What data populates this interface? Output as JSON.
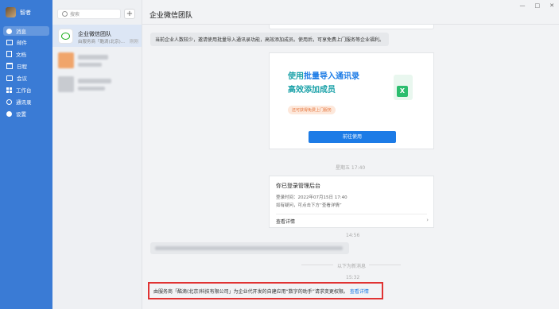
{
  "rail": {
    "user_name": "智者",
    "items": [
      {
        "label": "消息",
        "icon": "chat-icon"
      },
      {
        "label": "邮件",
        "icon": "mail-icon"
      },
      {
        "label": "文档",
        "icon": "doc-icon"
      },
      {
        "label": "日程",
        "icon": "calendar-icon"
      },
      {
        "label": "会议",
        "icon": "meeting-icon"
      },
      {
        "label": "工作台",
        "icon": "workbench-icon"
      },
      {
        "label": "通讯录",
        "icon": "contacts-icon"
      },
      {
        "label": "设置",
        "icon": "settings-icon"
      }
    ]
  },
  "list": {
    "search_placeholder": "搜索",
    "conversations": [
      {
        "name": "企业微信团队",
        "preview": "由服务商「酷滴(北京)...",
        "time": "刚刚"
      }
    ]
  },
  "main": {
    "title": "企业微信团队",
    "window_buttons": [
      "—",
      "□",
      "✕"
    ],
    "msg_intro": "当前企业人数较少，邀请使用批量导入通讯录功能，高效添加成员。使用后，可享免费上门服务等企业福利。",
    "banner": {
      "title_prefix": "使用",
      "title_highlight": "批量导入通讯录",
      "subtitle": "高效添加成员",
      "pill": "还可获得免费上门服务",
      "button": "前往使用"
    },
    "ts1": "星期五 17:40",
    "login": {
      "title": "你已登录管理后台",
      "line1": "登录时间：2022年07月15日 17:40",
      "line2": "如有疑问，可点击下方“查看详情”",
      "detail": "查看详情"
    },
    "ts2": "14:56",
    "new_msg_notice": "以下为新消息",
    "ts3": "15:32",
    "final_msg": "由服务商「酷滴(北京)科技有限公司」为企业代开发的自建应用“数字的助手”请求变更权限。",
    "final_link": "查看详情"
  },
  "colors": {
    "rail": "#3a7bd5",
    "accent": "#1c7be6",
    "highlight_box": "#e03333"
  }
}
